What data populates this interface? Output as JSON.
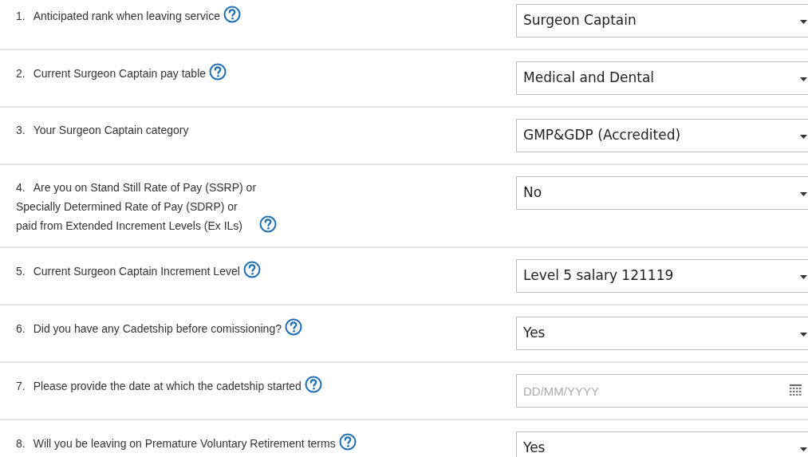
{
  "questions": [
    {
      "number": "1.",
      "lines": [
        "Anticipated rank when leaving service"
      ],
      "help": true,
      "control": {
        "kind": "select",
        "value": "Surgeon Captain"
      }
    },
    {
      "number": "2.",
      "lines": [
        "Current Surgeon Captain pay table"
      ],
      "help": true,
      "control": {
        "kind": "select",
        "value": "Medical and Dental"
      }
    },
    {
      "number": "3.",
      "lines": [
        "Your Surgeon Captain category"
      ],
      "help": false,
      "control": {
        "kind": "select",
        "value": "GMP&GDP (Accredited)"
      }
    },
    {
      "number": "4.",
      "lines": [
        "Are you on Stand Still Rate of Pay (SSRP) or",
        "Specially Determined Rate of Pay (SDRP) or",
        "paid from Extended Increment Levels (Ex ILs)"
      ],
      "help": true,
      "control": {
        "kind": "select",
        "value": "No"
      }
    },
    {
      "number": "5.",
      "lines": [
        "Current Surgeon Captain Increment Level"
      ],
      "help": true,
      "control": {
        "kind": "select",
        "value": "Level 5 salary 121119"
      }
    },
    {
      "number": "6.",
      "lines": [
        "Did you have any Cadetship before comissioning?"
      ],
      "help": true,
      "control": {
        "kind": "select",
        "value": "Yes"
      }
    },
    {
      "number": "7.",
      "lines": [
        "Please provide the date at which the cadetship started"
      ],
      "help": true,
      "control": {
        "kind": "date",
        "placeholder": "DD/MM/YYYY"
      }
    },
    {
      "number": "8.",
      "lines": [
        "Will you be leaving on Premature Voluntary Retirement terms"
      ],
      "help": true,
      "control": {
        "kind": "select",
        "value": "Yes"
      }
    }
  ]
}
